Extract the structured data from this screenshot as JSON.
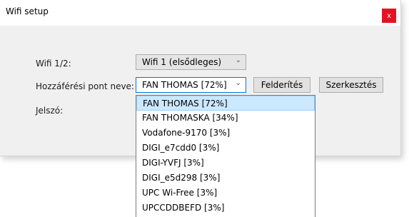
{
  "window": {
    "title": "Wifi setup",
    "close_label": "x",
    "close_color": "#e81123"
  },
  "form": {
    "wifi_label": "Wifi 1/2:",
    "wifi_value": "Wifi 1 (elsődleges)",
    "ap_label": "Hozzáférési pont neve:",
    "ap_value": "FAN THOMAS [72%]",
    "password_label": "Jelszó:",
    "discover_button": "Felderítés",
    "edit_button": "Szerkesztés"
  },
  "dropdown": {
    "selected_index": 0,
    "items": [
      "FAN THOMAS [72%]",
      "FAN THOMASKA [34%]",
      "Vodafone-9170 [3%]",
      "DIGI_e7cdd0 [3%]",
      "DIGI-YVFJ [3%]",
      "DIGI_e5d298 [3%]",
      "UPC Wi-Free [3%]",
      "UPCCDDBEFD [3%]"
    ]
  },
  "icons": {
    "chevron": "chevron-down-icon"
  },
  "colors": {
    "focus_border": "#0078d7",
    "selection_bg": "#cce8ff"
  }
}
